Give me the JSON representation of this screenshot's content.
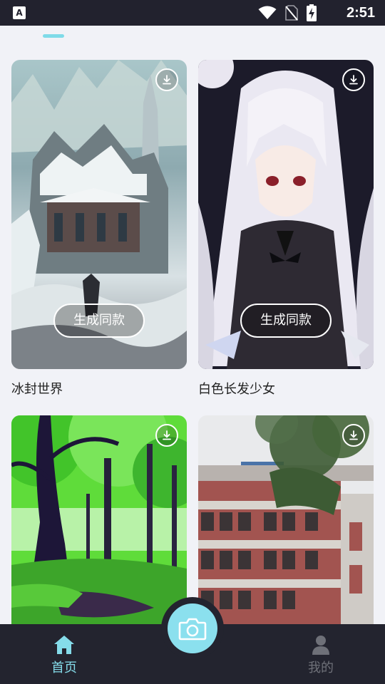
{
  "status_bar": {
    "app_badge": "A",
    "time": "2:51",
    "icons": [
      "wifi-icon",
      "no-sim-icon",
      "battery-charging-icon"
    ]
  },
  "feed": {
    "generate_label": "生成同款",
    "cards": [
      {
        "title": "冰封世界",
        "image": "frozen-castle-painting"
      },
      {
        "title": "白色长发少女",
        "image": "anime-girl-white-hair"
      },
      {
        "title": "",
        "image": "green-forest-trees"
      },
      {
        "title": "",
        "image": "school-building-photo"
      }
    ]
  },
  "bottom_nav": {
    "items": [
      {
        "label": "首页",
        "icon": "home-icon",
        "active": true
      },
      {
        "label": "我的",
        "icon": "user-icon",
        "active": false
      }
    ],
    "center_button_icon": "camera-icon"
  },
  "colors": {
    "accent": "#85dcea",
    "nav_background": "#23242f",
    "page_background": "#f1f2f7"
  }
}
